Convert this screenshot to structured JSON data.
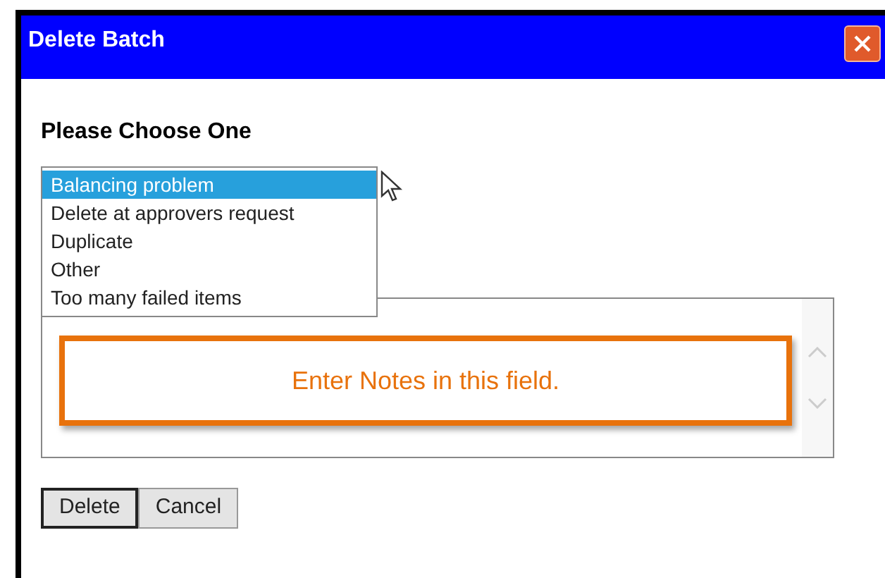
{
  "window": {
    "title": "Delete Batch"
  },
  "heading": "Please Choose One",
  "reasons": [
    {
      "label": "Balancing problem",
      "selected": true
    },
    {
      "label": "Delete at approvers request",
      "selected": false
    },
    {
      "label": "Duplicate",
      "selected": false
    },
    {
      "label": "Other",
      "selected": false
    },
    {
      "label": "Too many failed items",
      "selected": false
    }
  ],
  "notes": {
    "annotation": "Enter Notes in this field."
  },
  "buttons": [
    {
      "label": "Delete",
      "focused": true
    },
    {
      "label": "Cancel",
      "focused": false
    }
  ]
}
